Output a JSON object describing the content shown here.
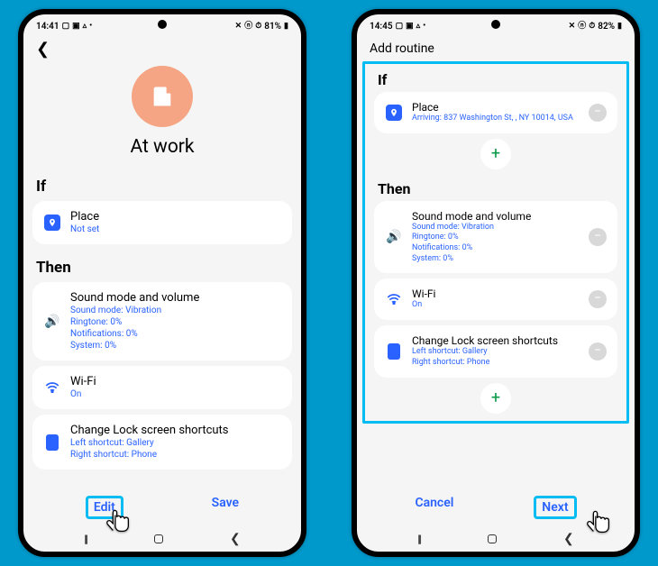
{
  "phone1": {
    "status": {
      "time": "14:41",
      "battery": "81%"
    },
    "hero": {
      "title": "At work"
    },
    "if_header": "If",
    "then_header": "Then",
    "place": {
      "title": "Place",
      "sub": "Not set"
    },
    "sound": {
      "title": "Sound mode and volume",
      "l1": "Sound mode: Vibration",
      "l2": "Ringtone: 0%",
      "l3": "Notifications: 0%",
      "l4": "System: 0%"
    },
    "wifi": {
      "title": "Wi-Fi",
      "sub": "On"
    },
    "lock": {
      "title": "Change Lock screen shortcuts",
      "l1": "Left shortcut: Gallery",
      "l2": "Right shortcut: Phone"
    },
    "edit": "Edit",
    "save": "Save"
  },
  "phone2": {
    "status": {
      "time": "14:45",
      "battery": "82%"
    },
    "header": "Add routine",
    "if_header": "If",
    "then_header": "Then",
    "place": {
      "title": "Place",
      "sub": "Arriving: 837 Washington St, , NY 10014, USA"
    },
    "sound": {
      "title": "Sound mode and volume",
      "l1": "Sound mode: Vibration",
      "l2": "Ringtone: 0%",
      "l3": "Notifications: 0%",
      "l4": "System: 0%"
    },
    "wifi": {
      "title": "Wi-Fi",
      "sub": "On"
    },
    "lock": {
      "title": "Change Lock screen shortcuts",
      "l1": "Left shortcut: Gallery",
      "l2": "Right shortcut: Phone"
    },
    "cancel": "Cancel",
    "next": "Next"
  }
}
